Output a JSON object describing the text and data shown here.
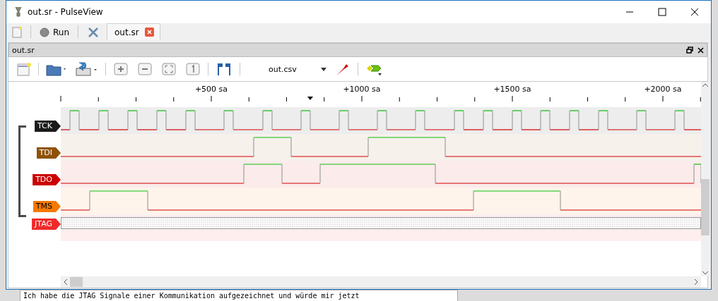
{
  "window": {
    "title": "out.sr - PulseView"
  },
  "main_toolbar": {
    "run_button": "Run"
  },
  "tabs": [
    {
      "label": "out.sr",
      "selected": true
    }
  ],
  "dock": {
    "title": "out.sr"
  },
  "session_toolbar": {
    "device": "out.csv"
  },
  "ruler": {
    "labels": [
      "+500 sa",
      "+1000 sa",
      "+1500 sa",
      "+2000 sa"
    ]
  },
  "signals": [
    {
      "name": "TCK",
      "color": "#1a1a1a"
    },
    {
      "name": "TDI",
      "color": "#8f5202"
    },
    {
      "name": "TDO",
      "color": "#cc0000"
    },
    {
      "name": "TMS",
      "color": "#f57900"
    }
  ],
  "decoders": [
    {
      "name": "JTAG",
      "color": "#ef2929"
    }
  ],
  "below_text": "Ich habe die JTAG Signale einer Kommunikation aufgezeichnet und würde mir jetzt"
}
